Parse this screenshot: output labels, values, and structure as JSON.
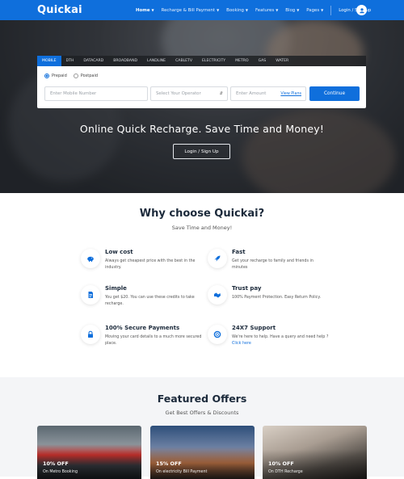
{
  "brand": "Quickai",
  "nav": {
    "items": [
      {
        "label": "Home"
      },
      {
        "label": "Recharge & Bill Payment"
      },
      {
        "label": "Booking"
      },
      {
        "label": "Features"
      },
      {
        "label": "Blog"
      },
      {
        "label": "Pages"
      }
    ],
    "login_label": "Login / Sign up",
    "avatar_icon": "user-icon"
  },
  "recharge": {
    "tabs": [
      "MOBILE",
      "DTH",
      "DATACARD",
      "BROADBAND",
      "LANDLINE",
      "CABLETV",
      "ELECTRICITY",
      "METRO",
      "GAS",
      "WATER"
    ],
    "active_tab": "MOBILE",
    "plan_options": [
      "Prepaid",
      "Postpaid"
    ],
    "selected_plan": "Prepaid",
    "mobile_placeholder": "Enter Mobile Number",
    "operator_placeholder": "Select Your Operator",
    "amount_placeholder": "Enter Amount",
    "view_plans_label": "View Plans",
    "continue_label": "Continue"
  },
  "hero": {
    "title": "Online Quick Recharge. Save Time and Money!",
    "button_label": "Login / Sign Up"
  },
  "why": {
    "title": "Why choose Quickai?",
    "subtitle": "Save Time and Money!",
    "features": [
      {
        "icon": "piggy-bank-icon",
        "title": "Low cost",
        "desc": "Always get cheapest price with the best in the industry."
      },
      {
        "icon": "rocket-icon",
        "title": "Fast",
        "desc": "Get your recharge to family and friends in minutes"
      },
      {
        "icon": "document-icon",
        "title": "Simple",
        "desc": "You get $20. You can use these credits to take recharge."
      },
      {
        "icon": "handshake-icon",
        "title": "Trust pay",
        "desc": "100% Payment Protection. Easy Return Policy."
      },
      {
        "icon": "lock-icon",
        "title": "100% Secure Payments",
        "desc": "Moving your card details to a much more secured place."
      },
      {
        "icon": "lifebuoy-icon",
        "title": "24X7 Support",
        "desc": "We're here to help. Have a query and need help ?",
        "link": "Click here"
      }
    ]
  },
  "offers": {
    "title": "Featured Offers",
    "subtitle": "Get Best Offers & Discounts",
    "cards": [
      {
        "percent": "10% OFF",
        "on": "On Metro Booking"
      },
      {
        "percent": "15% OFF",
        "on": "On electricity Bill Payment"
      },
      {
        "percent": "10% OFF",
        "on": "On DTH Recharge"
      }
    ]
  },
  "colors": {
    "primary": "#0f6fdc",
    "heading": "#1c2a3b"
  }
}
